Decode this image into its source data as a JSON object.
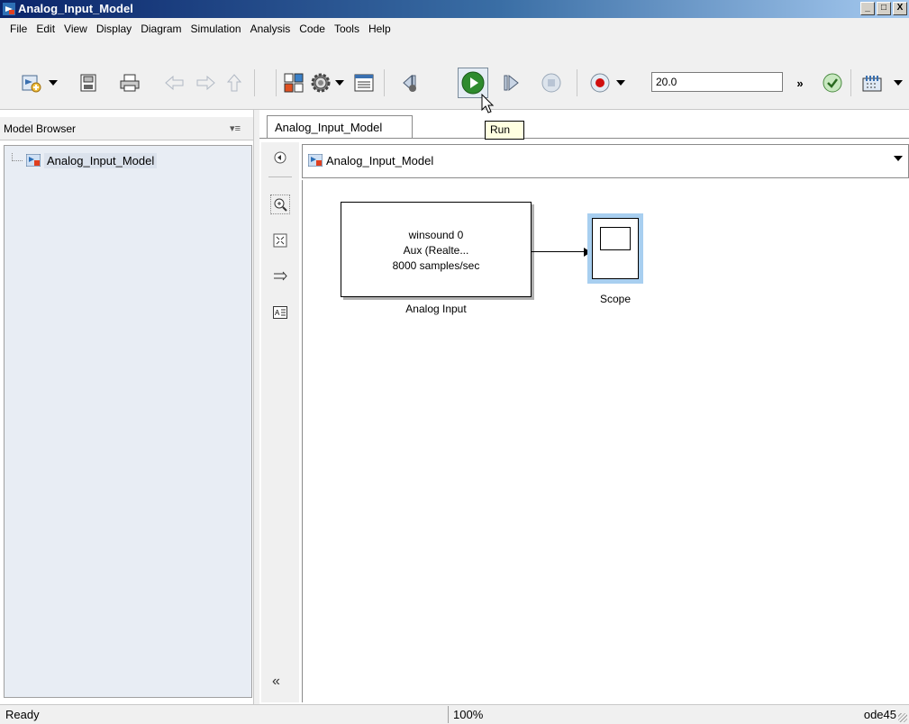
{
  "window": {
    "title": "Analog_Input_Model",
    "buttons": [
      "_",
      "□",
      "X"
    ]
  },
  "menu": {
    "items": [
      "File",
      "Edit",
      "View",
      "Display",
      "Diagram",
      "Simulation",
      "Analysis",
      "Code",
      "Tools",
      "Help"
    ]
  },
  "toolbar": {
    "stop_time": "20.0",
    "more_label": "»",
    "tooltip": "Run",
    "icons": [
      "new-model-icon",
      "save-icon",
      "print-icon",
      "back-arrow-icon",
      "forward-arrow-icon",
      "up-arrow-icon",
      "library-browser-icon",
      "model-settings-icon",
      "model-explorer-icon",
      "step-back-icon",
      "run-icon",
      "step-forward-icon",
      "stop-icon",
      "record-icon",
      "check-icon",
      "build-icon"
    ]
  },
  "browser": {
    "header": "Model Browser",
    "menu_glyph": "▾≡",
    "tree": [
      {
        "label": "Analog_Input_Model"
      }
    ]
  },
  "editor": {
    "tab": "Analog_Input_Model",
    "address": "Analog_Input_Model",
    "collapse_glyph": "«"
  },
  "blocks": {
    "analog_input": {
      "line1": "winsound 0",
      "line2": "Aux (Realte...",
      "line3": "8000 samples/sec",
      "label": "Analog Input"
    },
    "scope": {
      "label": "Scope"
    }
  },
  "status": {
    "state": "Ready",
    "zoom": "100%",
    "solver": "ode45"
  },
  "colors": {
    "titlebar_start": "#0a246a",
    "selection": "#a8cff0",
    "tooltip_bg": "#ffffe1"
  }
}
